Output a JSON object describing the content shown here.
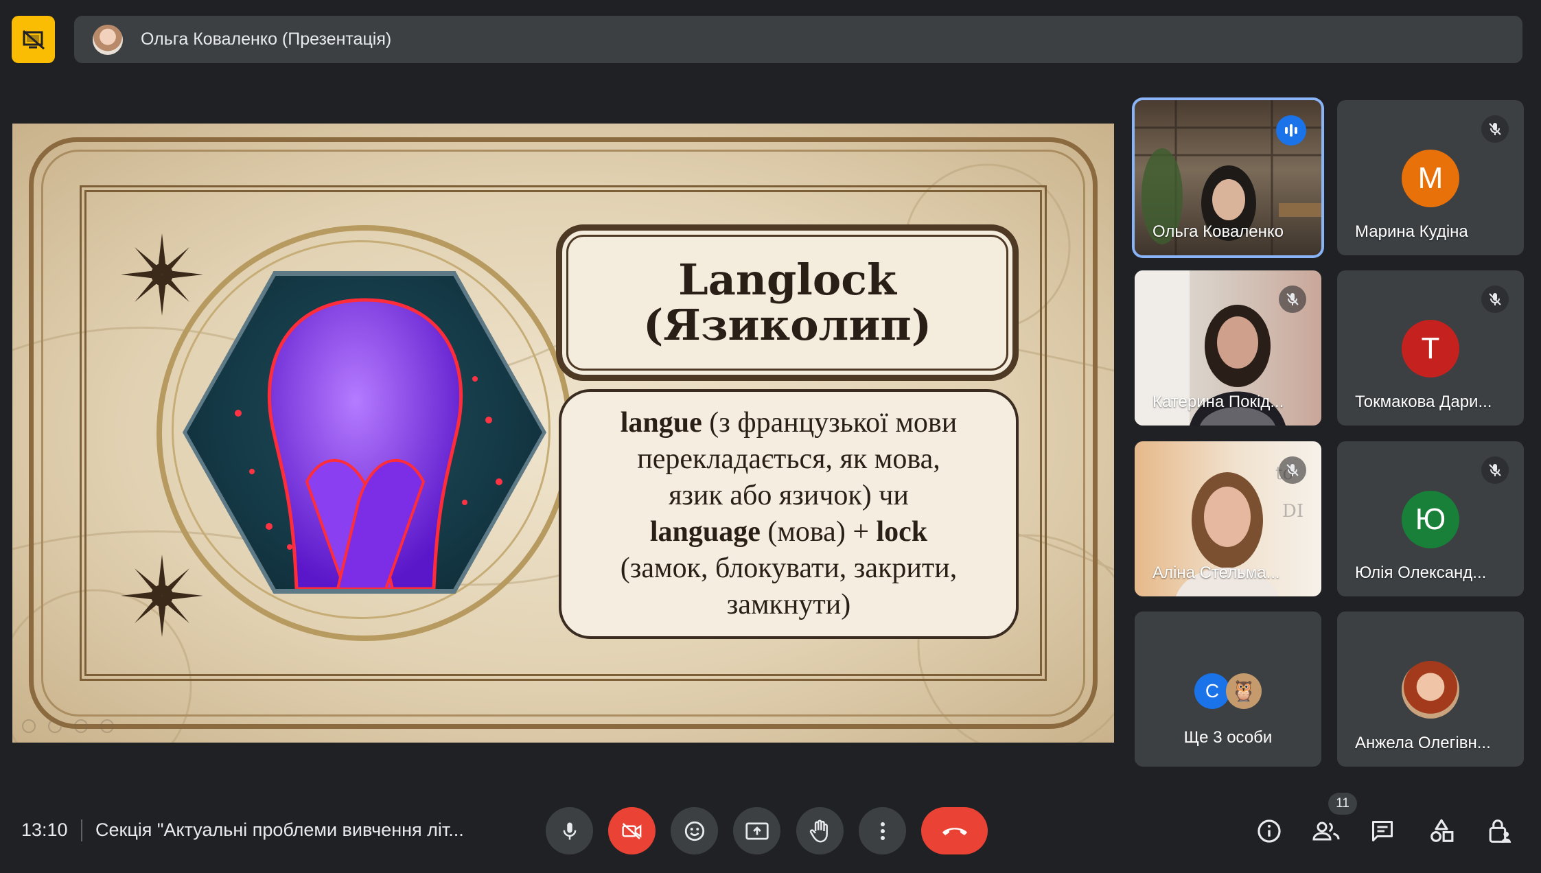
{
  "top_bar": {
    "icon": "presentation-off-icon",
    "presenter_title": "Ольга Коваленко (Презентація)"
  },
  "slide": {
    "title_lines": [
      "Langlock",
      "(Язиколип)"
    ],
    "body_lines": [
      [
        {
          "text": "langue",
          "bold": true
        },
        {
          "text": " (з французької мови",
          "bold": false
        }
      ],
      [
        {
          "text": "перекладається, як мова,",
          "bold": false
        }
      ],
      [
        {
          "text": "язик або язичок) чи",
          "bold": false
        }
      ],
      [
        {
          "text": "language",
          "bold": true
        },
        {
          "text": " (мова) + ",
          "bold": false
        },
        {
          "text": "lock",
          "bold": true
        }
      ],
      [
        {
          "text": "(замок, блокувати, закрити,",
          "bold": false
        }
      ],
      [
        {
          "text": "замкнути)",
          "bold": false
        }
      ]
    ]
  },
  "participants": [
    {
      "name": "Ольга Коваленко",
      "type": "video",
      "speaking": true,
      "muted": false
    },
    {
      "name": "Марина Кудіна",
      "type": "avatar",
      "initial": "М",
      "color": "#e8710a",
      "muted": true
    },
    {
      "name": "Катерина Покід...",
      "type": "video",
      "muted": true
    },
    {
      "name": "Токмакова Дари...",
      "type": "avatar",
      "initial": "Т",
      "color": "#c5221f",
      "muted": true
    },
    {
      "name": "Аліна Стельма...",
      "type": "video",
      "muted": true
    },
    {
      "name": "Юлія Олександ...",
      "type": "avatar",
      "initial": "Ю",
      "color": "#188038",
      "muted": true
    },
    {
      "name": "Ще 3 особи",
      "type": "more",
      "initial": "С"
    },
    {
      "name": "Анжела Олегівн...",
      "type": "photo",
      "muted": false
    }
  ],
  "bottom_bar": {
    "time": "13:10",
    "meeting_title": "Секція \"Актуальні проблеми вивчення літ...",
    "participants_count": "11"
  },
  "colors": {
    "background": "#202124",
    "control_bg": "#3c4043",
    "danger": "#ea4335",
    "accent": "#8ab4f8",
    "presenter_badge": "#fbbc04"
  }
}
